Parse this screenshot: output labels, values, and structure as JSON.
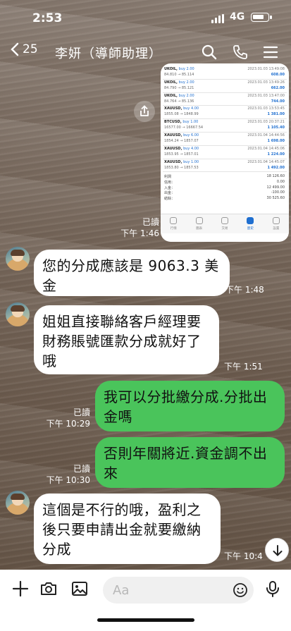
{
  "status": {
    "time": "2:53",
    "network": "4G"
  },
  "header": {
    "back_count": "25",
    "title": "李妍（導師助理）"
  },
  "image_message": {
    "trades": [
      {
        "symbol": "UKOIL",
        "side": "buy 2.00",
        "date": "2023.01.03 13:49:08",
        "price": "84.810 → 85.114",
        "pl": "608.00"
      },
      {
        "symbol": "UKOIL",
        "side": "buy 2.00",
        "date": "2023.01.03 13:49:26",
        "price": "84.790 → 85.121",
        "pl": "662.00"
      },
      {
        "symbol": "UKOIL",
        "side": "buy 2.00",
        "date": "2023.01.03 13:47:00",
        "price": "84.764 → 85.136",
        "pl": "744.00"
      },
      {
        "symbol": "XAUUSD",
        "side": "buy 4.00",
        "date": "2023.01.03 13:53:45",
        "price": "1855.08 → 1848.99",
        "pl": "1 381.00"
      },
      {
        "symbol": "BTCUSD",
        "side": "buy 1.00",
        "date": "2023.01.03 20:37:21",
        "price": "16577.00 → 16667.54",
        "pl": "1 105.40"
      },
      {
        "symbol": "XAUUSD",
        "side": "buy 6.00",
        "date": "2023.01.04 14:44:56",
        "price": "1854.24 → 1857.07",
        "pl": "1 698.00"
      },
      {
        "symbol": "XAUUSD",
        "side": "buy 4.00",
        "date": "2023.01.04 14:45:06",
        "price": "1853.95 → 1857.01",
        "pl": "1 224.00"
      },
      {
        "symbol": "XAUUSD",
        "side": "buy 1.00",
        "date": "2023.01.04 14:45:07",
        "price": "1853.80 → 1857.53",
        "pl": "1 492.00"
      }
    ],
    "summary": [
      {
        "label": "利潤",
        "value": "18 126.60"
      },
      {
        "label": "信用：",
        "value": "0.00"
      },
      {
        "label": "入金：",
        "value": "12 499.00"
      },
      {
        "label": "出金：",
        "value": "-100.00"
      },
      {
        "label": "結餘：",
        "value": "30 525.60"
      }
    ],
    "tabs": [
      {
        "label": "行情",
        "active": false
      },
      {
        "label": "圖表",
        "active": false
      },
      {
        "label": "交易",
        "active": false
      },
      {
        "label": "歷史",
        "active": true
      },
      {
        "label": "設置",
        "active": false
      }
    ],
    "read": "已讀",
    "time": "下午 1:46"
  },
  "messages": [
    {
      "text": "您的分成應該是 9063.3 美金",
      "time": "下午 1:48"
    },
    {
      "text": "姐姐直接聯絡客戶經理要財務賬號匯款分成就好了哦",
      "time": "下午 1:51"
    },
    {
      "text": "我可以分批繳分成.分批出金嗎",
      "read": "已讀",
      "time": "下午 10:29"
    },
    {
      "text": "否則年關將近.資金調不出來",
      "read": "已讀",
      "time": "下午 10:30"
    },
    {
      "text": "這個是不行的哦，盈利之後只要申請出金就要繳納分成",
      "time": "下午 10:4"
    }
  ],
  "input": {
    "placeholder": "Aa"
  }
}
